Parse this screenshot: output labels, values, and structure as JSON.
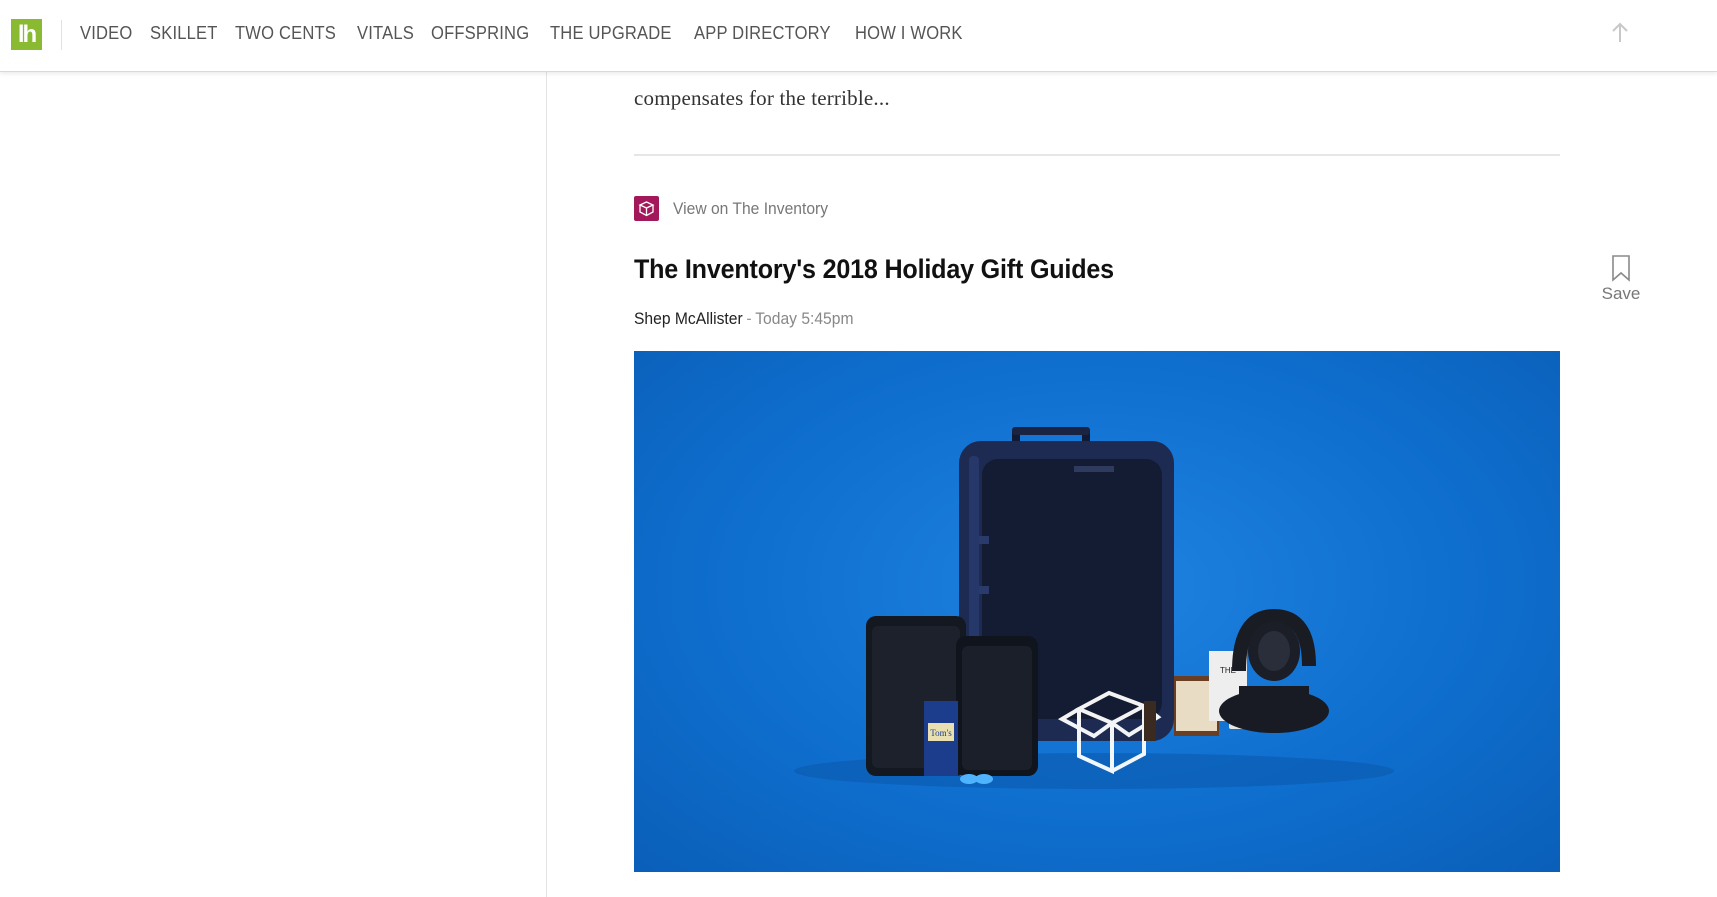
{
  "header": {
    "logo_text": "lh",
    "nav": [
      "VIDEO",
      "SKILLET",
      "TWO CENTS",
      "VITALS",
      "OFFSPRING",
      "THE UPGRADE",
      "APP DIRECTORY",
      "HOW I WORK"
    ],
    "brand_color": "#8ab932"
  },
  "previous_article": {
    "excerpt_end": "compensates for the terrible..."
  },
  "article": {
    "source_label": "View on The Inventory",
    "source_icon": "box-icon",
    "source_color": "#a3185a",
    "title": "The Inventory's 2018 Holiday Gift Guides",
    "author": "Shep McAllister",
    "separator": "-",
    "timestamp": "Today 5:45pm",
    "save_label": "Save",
    "hero_background": "#0f6fcf"
  }
}
